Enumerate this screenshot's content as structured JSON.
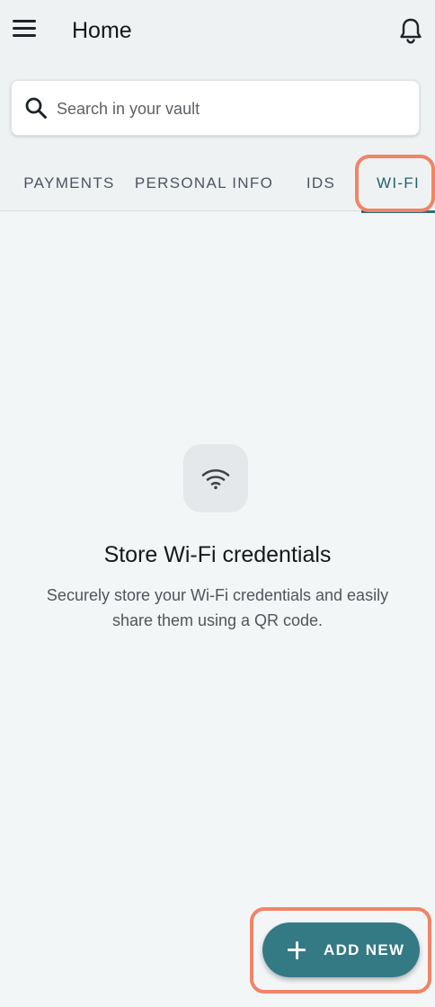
{
  "header": {
    "title": "Home",
    "menu_icon": "menu-icon",
    "notification_icon": "bell-icon"
  },
  "search": {
    "placeholder": "Search in your vault",
    "value": ""
  },
  "tabs": [
    {
      "label": "PAYMENTS"
    },
    {
      "label": "PERSONAL INFO"
    },
    {
      "label": "IDS"
    },
    {
      "label": "WI-FI",
      "selected": true
    }
  ],
  "empty_state": {
    "icon": "wifi-icon",
    "title": "Store Wi-Fi credentials",
    "description": "Securely store your Wi-Fi credentials and easily share them using a QR code."
  },
  "fab": {
    "label": "ADD NEW",
    "icon": "plus-icon"
  },
  "colors": {
    "accent": "#347a85",
    "highlight": "#f28366",
    "background": "#f3f6f7"
  }
}
